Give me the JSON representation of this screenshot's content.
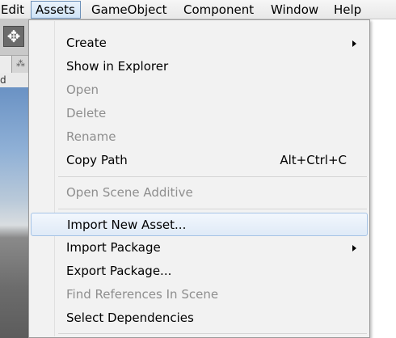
{
  "menubar": {
    "items": [
      {
        "label": "Edit"
      },
      {
        "label": "Assets"
      },
      {
        "label": "GameObject"
      },
      {
        "label": "Component"
      },
      {
        "label": "Window"
      },
      {
        "label": "Help"
      }
    ]
  },
  "background": {
    "move_tool_glyph": "✥",
    "tab_icon_glyph": "⁂",
    "hierarchy_text": "d"
  },
  "assets_menu": {
    "items": [
      {
        "label": "Create",
        "enabled": true,
        "submenu": true,
        "shortcut": ""
      },
      {
        "label": "Show in Explorer",
        "enabled": true,
        "submenu": false,
        "shortcut": ""
      },
      {
        "label": "Open",
        "enabled": false,
        "submenu": false,
        "shortcut": ""
      },
      {
        "label": "Delete",
        "enabled": false,
        "submenu": false,
        "shortcut": ""
      },
      {
        "label": "Rename",
        "enabled": false,
        "submenu": false,
        "shortcut": ""
      },
      {
        "label": "Copy Path",
        "enabled": true,
        "submenu": false,
        "shortcut": "Alt+Ctrl+C"
      },
      {
        "label": "Open Scene Additive",
        "enabled": false,
        "submenu": false,
        "shortcut": ""
      },
      {
        "label": "Import New Asset...",
        "enabled": true,
        "submenu": false,
        "shortcut": "",
        "highlighted": true
      },
      {
        "label": "Import Package",
        "enabled": true,
        "submenu": true,
        "shortcut": ""
      },
      {
        "label": "Export Package...",
        "enabled": true,
        "submenu": false,
        "shortcut": ""
      },
      {
        "label": "Find References In Scene",
        "enabled": false,
        "submenu": false,
        "shortcut": ""
      },
      {
        "label": "Select Dependencies",
        "enabled": true,
        "submenu": false,
        "shortcut": ""
      }
    ]
  },
  "colors": {
    "highlight_border": "#a6c4e6",
    "disabled_text": "#8e8e8e",
    "active_menu_border": "#6b8fb8"
  }
}
